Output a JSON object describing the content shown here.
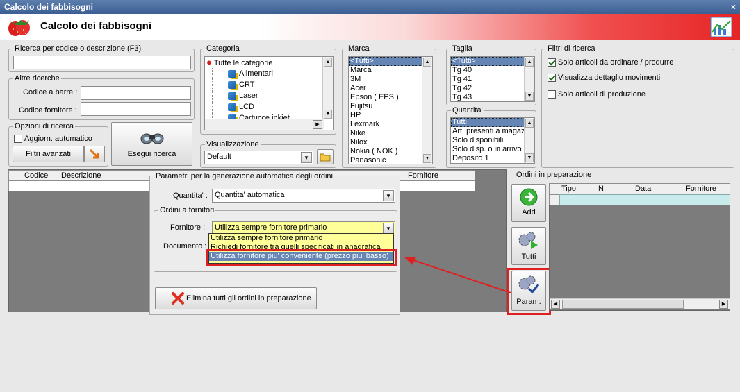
{
  "window": {
    "title": "Calcolo dei fabbisogni",
    "close_glyph": "×"
  },
  "header": {
    "title": "Calcolo dei fabbisogni"
  },
  "search": {
    "group_label": "Ricerca per codice o descrizione (F3)",
    "value": ""
  },
  "altre_ricerche": {
    "group_label": "Altre ricerche",
    "codice_barre_label": "Codice a barre :",
    "codice_fornitore_label": "Codice fornitore :"
  },
  "opzioni": {
    "group_label": "Opzioni di ricerca",
    "aggiorn_label": "Aggiorn. automatico",
    "aggiorn_checked": false,
    "filtri_label": "Filtri avanzati"
  },
  "esegui": {
    "label": "Esegui ricerca"
  },
  "categoria": {
    "group_label": "Categoria",
    "items": [
      "Tutte le categorie",
      "Alimentari",
      "CRT",
      "Laser",
      "LCD",
      "Cartucce inkjet"
    ]
  },
  "visualizzazione": {
    "group_label": "Visualizzazione",
    "value": "Default"
  },
  "marca": {
    "group_label": "Marca",
    "items": [
      "<Tutti>",
      "Marca",
      "3M",
      "Acer",
      "Epson ( EPS )",
      "Fujitsu",
      "HP",
      "Lexmark",
      "Nike",
      "Nilox",
      "Nokia ( NOK )",
      "Panasonic"
    ]
  },
  "taglia": {
    "group_label": "Taglia",
    "items": [
      "<Tutti>",
      "Tg 40",
      "Tg 41",
      "Tg 42",
      "Tg 43"
    ]
  },
  "quantita_filter": {
    "group_label": "Quantita'",
    "items": [
      "Tutti",
      "Art. presenti a magazzino",
      "Solo disponibili",
      "Solo disp. o in arrivo",
      "Deposito 1"
    ]
  },
  "filtri": {
    "group_label": "Filtri di ricerca",
    "items": [
      {
        "label": "Solo articoli da ordinare / produrre",
        "checked": true
      },
      {
        "label": "Visualizza dettaglio movimenti",
        "checked": true
      },
      {
        "label": "Solo articoli di produzione",
        "checked": false
      }
    ]
  },
  "main_grid": {
    "columns": [
      "Codice",
      "Descrizione",
      "Fornitore"
    ]
  },
  "params": {
    "group_label": "Parametri per la generazione automatica degli ordini",
    "quantita_label": "Quantita' :",
    "quantita_value": "Quantita' automatica",
    "ordini_label": "Ordini a fornitori",
    "fornitore_label": "Fornitore :",
    "fornitore_value": "Utilizza sempre fornitore primario",
    "documento_label": "Documento :",
    "options": [
      "Utilizza sempre fornitore primario",
      "Richiedi fornitore tra quelli specificati in anagrafica",
      "Utilizza fornitore piu' conveniente (prezzo piu' basso)"
    ],
    "elimina_label": "Elimina tutti gli ordini in preparazione"
  },
  "side_buttons": {
    "add": "Add",
    "tutti": "Tutti",
    "param": "Param."
  },
  "ordini": {
    "group_label": "Ordini in preparazione",
    "columns": [
      "Tipo",
      "N.",
      "Data",
      "Fornitore"
    ]
  },
  "colors": {
    "highlight": "#e02020",
    "selection": "#6585b5",
    "dropdown_bg": "#ffff99",
    "grid_row": "#c8ecec"
  },
  "icons": [
    "strawberry-icon",
    "chart-icon",
    "binoculars-icon",
    "arrow-icon",
    "folder-icon",
    "add-icon",
    "gears-play-icon",
    "gears-check-icon",
    "delete-x-icon"
  ]
}
